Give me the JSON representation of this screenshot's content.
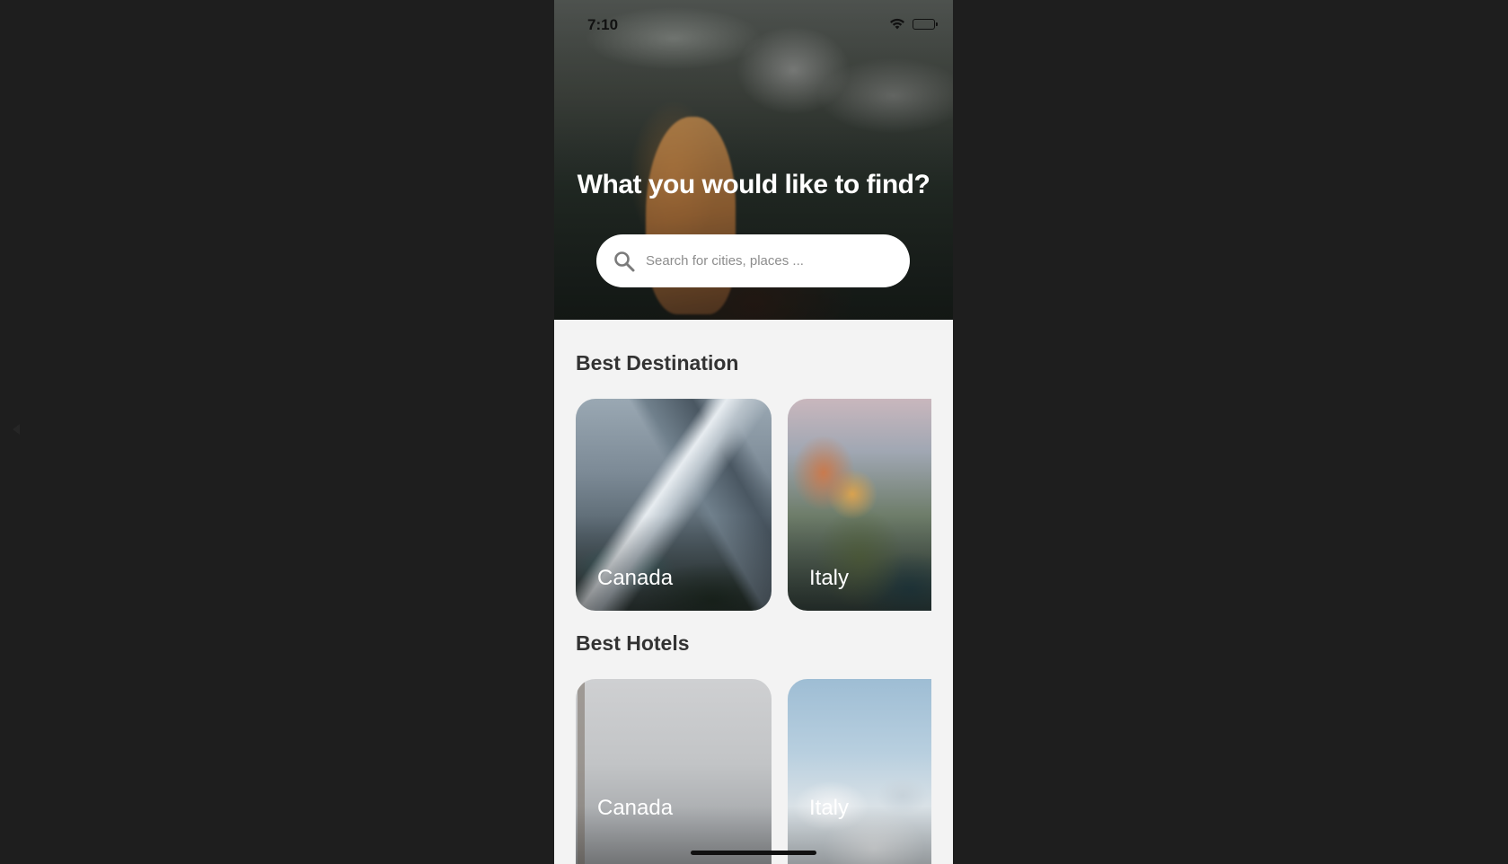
{
  "status_bar": {
    "time": "7:10"
  },
  "hero": {
    "title": "What you would like to find?",
    "search": {
      "placeholder": "Search for cities, places ...",
      "value": ""
    }
  },
  "best_destination": {
    "title": "Best Destination",
    "cards": [
      {
        "label": "Canada"
      },
      {
        "label": "Italy"
      }
    ]
  },
  "best_hotels": {
    "title": "Best Hotels",
    "cards": [
      {
        "label": "Canada"
      },
      {
        "label": "Italy"
      }
    ]
  },
  "icons": [
    "search-icon",
    "wifi-icon",
    "battery-icon"
  ]
}
